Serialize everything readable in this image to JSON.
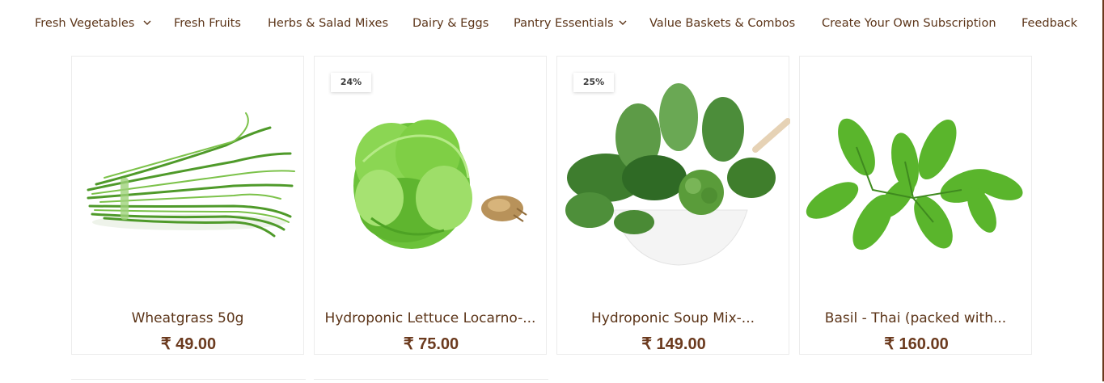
{
  "nav": {
    "items": [
      {
        "label": "Fresh Vegetables",
        "has_dropdown": true
      },
      {
        "label": "Fresh Fruits",
        "has_dropdown": false
      },
      {
        "label": "Herbs & Salad Mixes",
        "has_dropdown": false
      },
      {
        "label": "Dairy & Eggs",
        "has_dropdown": false
      },
      {
        "label": "Pantry Essentials",
        "has_dropdown": true
      },
      {
        "label": "Value Baskets & Combos",
        "has_dropdown": false
      },
      {
        "label": "Create Your Own Subscription",
        "has_dropdown": false
      },
      {
        "label": "Feedback",
        "has_dropdown": false
      }
    ]
  },
  "products": [
    {
      "name": "Wheatgrass 50g",
      "price": "₹ 49.00",
      "badge": "",
      "image": "wheatgrass-image"
    },
    {
      "name": "Hydroponic Lettuce Locarno-...",
      "price": "₹ 75.00",
      "badge": "24%",
      "image": "lettuce-image"
    },
    {
      "name": "Hydroponic Soup Mix-...",
      "price": "₹ 149.00",
      "badge": "25%",
      "image": "soup-mix-image"
    },
    {
      "name": "Basil - Thai (packed with...",
      "price": "₹ 160.00",
      "badge": "",
      "image": "thai-basil-image"
    }
  ],
  "colors": {
    "text": "#5c3519",
    "price": "#6b3a1e",
    "border": "#ececec",
    "leaf": "#5fae2e"
  }
}
